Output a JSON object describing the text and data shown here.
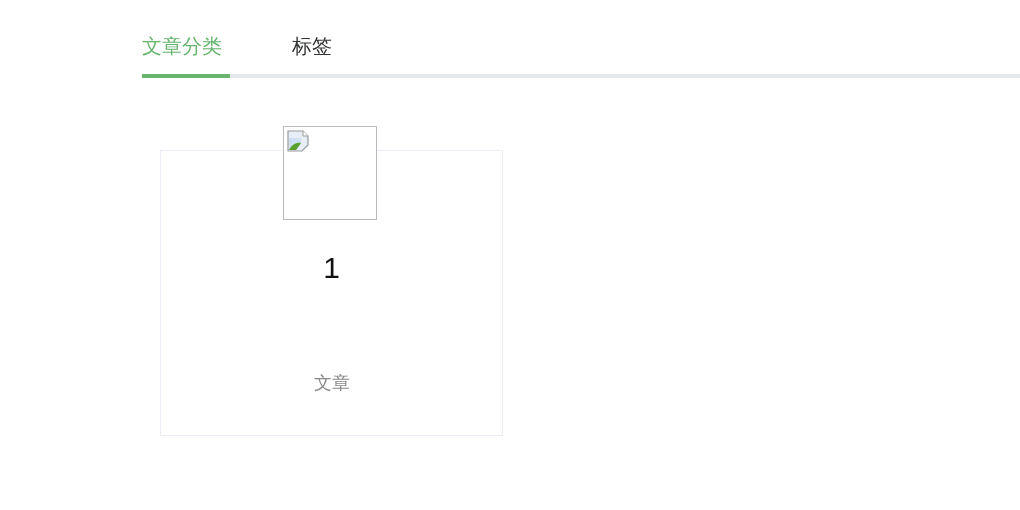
{
  "tabs": [
    {
      "label": "文章分类",
      "selected": true
    },
    {
      "label": "标签",
      "selected": false
    }
  ],
  "cards": [
    {
      "image": {
        "kind": "broken-image"
      },
      "count": "1",
      "label": "文章"
    }
  ]
}
